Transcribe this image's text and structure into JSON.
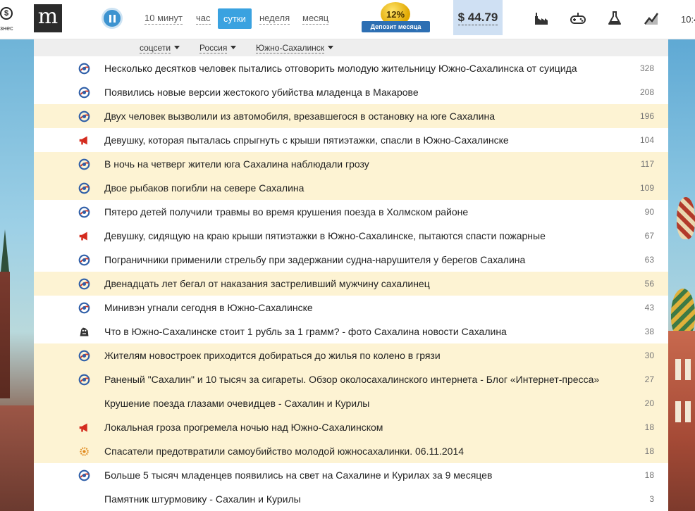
{
  "topbar": {
    "biz_glyph": "$",
    "biz_label": "знес",
    "logo_letter": "m",
    "periods": [
      "10 минут",
      "час",
      "сутки",
      "неделя",
      "месяц"
    ],
    "active_period": "сутки",
    "badge": {
      "percent": "12%",
      "label": "Депозит месяца"
    },
    "price": "$ 44.79",
    "clock_fragment": "10:4"
  },
  "filters": [
    {
      "label": "соцсети"
    },
    {
      "label": "Россия"
    },
    {
      "label": "Южно-Сахалинск"
    }
  ],
  "colors": {
    "accent": "#3aa2e0",
    "highlight_row": "#fdf3d3",
    "badge_gold": "#e1a800",
    "price_bg": "#cfe0f3"
  },
  "news": [
    {
      "title": "Несколько десятков человек пытались отговорить молодую жительницу Южно-Сахалинска от суицида",
      "count": "328",
      "icon": "circle-logo-icon",
      "highlight": false
    },
    {
      "title": "Появились новые версии жестокого убийства младенца в Макарове",
      "count": "208",
      "icon": "circle-logo-icon",
      "highlight": false
    },
    {
      "title": "Двух человек вызволили из автомобиля, врезавшегося в остановку на юге Сахалина",
      "count": "196",
      "icon": "circle-logo-icon",
      "highlight": true
    },
    {
      "title": "Девушку, которая пыталась спрыгнуть с крыши пятиэтажки, спасли в Южно-Сахалинске",
      "count": "104",
      "icon": "megaphone-icon",
      "highlight": false
    },
    {
      "title": "В ночь на четверг жители юга Сахалина наблюдали грозу",
      "count": "117",
      "icon": "circle-logo-icon",
      "highlight": true
    },
    {
      "title": "Двое рыбаков погибли на севере Сахалина",
      "count": "109",
      "icon": "circle-logo-icon",
      "highlight": true
    },
    {
      "title": "Пятеро детей получили травмы во время крушения поезда в Холмском районе",
      "count": "90",
      "icon": "circle-logo-icon",
      "highlight": false
    },
    {
      "title": "Девушку, сидящую на краю крыши пятиэтажки в Южно-Сахалинске, пытаются спасти пожарные",
      "count": "67",
      "icon": "megaphone-icon",
      "highlight": false
    },
    {
      "title": "Пограничники применили стрельбу при задержании судна-нарушителя у берегов Сахалина",
      "count": "63",
      "icon": "circle-logo-icon",
      "highlight": false
    },
    {
      "title": "Двенадцать лет бегал от наказания застреливший мужчину сахалинец",
      "count": "56",
      "icon": "circle-logo-icon",
      "highlight": true
    },
    {
      "title": "Минивэн угнали сегодня в Южно-Сахалинске",
      "count": "43",
      "icon": "circle-logo-icon",
      "highlight": false
    },
    {
      "title": "Что в Южно-Сахалинске стоит 1 рубль за 1 грамм? - фото Сахалина новости Сахалина",
      "count": "38",
      "icon": "animal-logo-icon",
      "highlight": false
    },
    {
      "title": "Жителям новостроек приходится добираться до жилья по колено в грязи",
      "count": "30",
      "icon": "circle-logo-icon",
      "highlight": true
    },
    {
      "title": "Раненый \"Сахалин\" и 10 тысяч за сигареты. Обзор околосахалинского интернета - Блог «Интернет-пресса»",
      "count": "27",
      "icon": "circle-logo-icon",
      "highlight": true
    },
    {
      "title": "Крушение поезда глазами очевидцев - Сахалин и Курилы",
      "count": "20",
      "icon": "none",
      "highlight": true
    },
    {
      "title": "Локальная гроза прогремела ночью над Южно-Сахалинском",
      "count": "18",
      "icon": "megaphone-icon",
      "highlight": true
    },
    {
      "title": "Спасатели предотвратили самоубийство молодой южносахалинки. 06.11.2014",
      "count": "18",
      "icon": "emblem-icon",
      "highlight": true
    },
    {
      "title": "Больше 5 тысяч младенцев появились на свет на Сахалине и Курилах за 9 месяцев",
      "count": "18",
      "icon": "circle-logo-icon",
      "highlight": false
    },
    {
      "title": "Памятник штурмовику - Сахалин и Курилы",
      "count": "3",
      "icon": "none",
      "highlight": false
    }
  ]
}
